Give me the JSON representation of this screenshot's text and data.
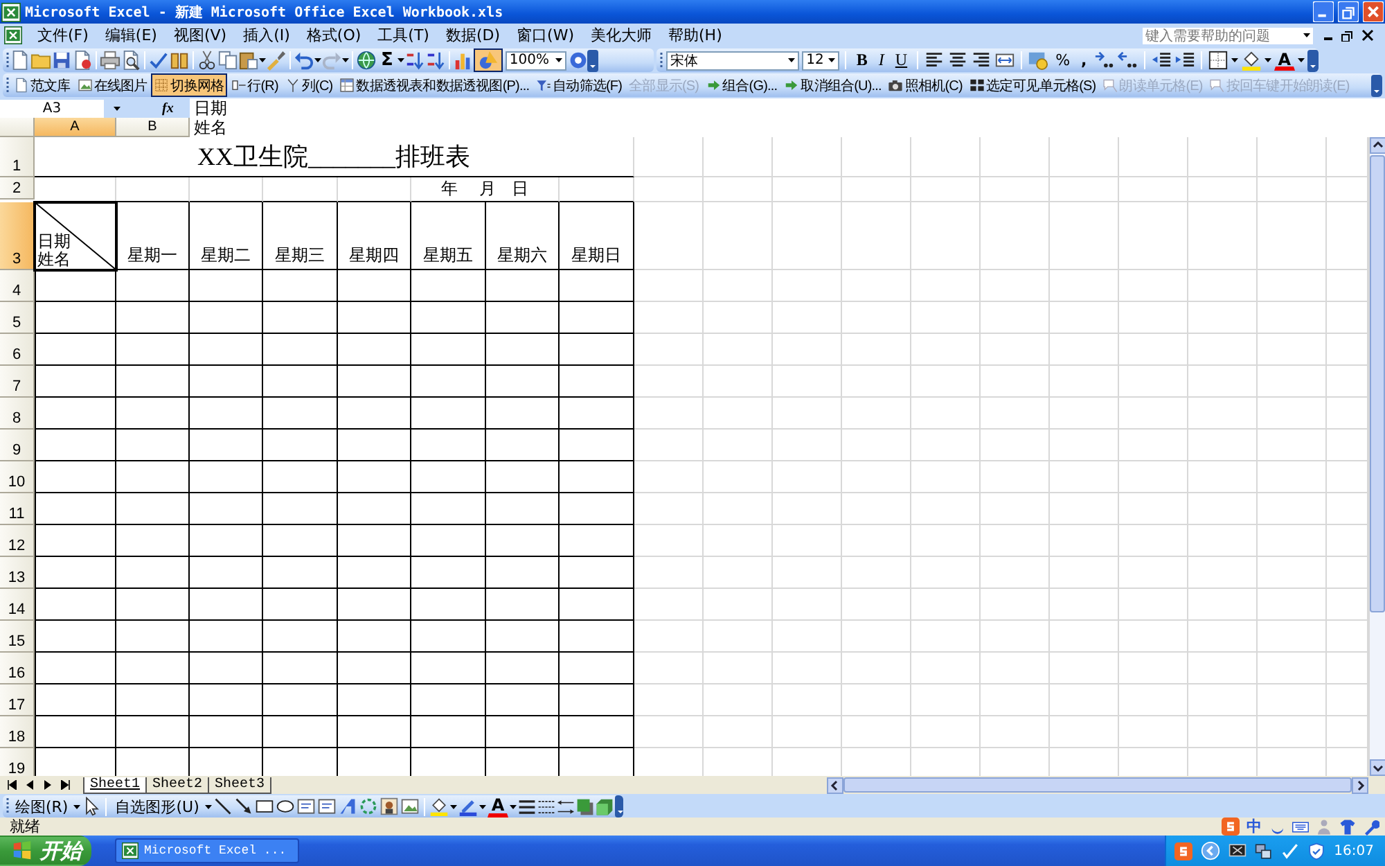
{
  "window": {
    "title": "Microsoft Excel - 新建 Microsoft Office Excel Workbook.xls"
  },
  "menu": {
    "items": [
      "文件(F)",
      "编辑(E)",
      "视图(V)",
      "插入(I)",
      "格式(O)",
      "工具(T)",
      "数据(D)",
      "窗口(W)",
      "美化大师",
      "帮助(H)"
    ],
    "help_placeholder": "键入需要帮助的问题"
  },
  "standard_toolbar": {
    "sum": "Σ",
    "zoom": "100%",
    "drawing_pressed": true
  },
  "formatting_toolbar": {
    "font": "宋体",
    "size": "12",
    "bold": "B",
    "italic": "I",
    "underline": "U",
    "percent": "%",
    "comma": ",",
    "font_color": "A"
  },
  "custom_toolbar": {
    "items": [
      {
        "label": "范文库",
        "pressed": false,
        "disabled": false
      },
      {
        "label": "在线图片",
        "pressed": false,
        "disabled": false
      },
      {
        "label": "切换网格",
        "pressed": true,
        "disabled": false
      },
      {
        "label": "行(R)",
        "pressed": false,
        "disabled": false
      },
      {
        "label": "列(C)",
        "pressed": false,
        "disabled": false
      },
      {
        "label": "数据透视表和数据透视图(P)...",
        "pressed": false,
        "disabled": false
      },
      {
        "label": "自动筛选(F)",
        "pressed": false,
        "disabled": false
      },
      {
        "label": "全部显示(S)",
        "pressed": false,
        "disabled": true
      },
      {
        "label": "组合(G)...",
        "pressed": false,
        "disabled": false
      },
      {
        "label": "取消组合(U)...",
        "pressed": false,
        "disabled": false
      },
      {
        "label": "照相机(C)",
        "pressed": false,
        "disabled": false
      },
      {
        "label": "选定可见单元格(S)",
        "pressed": false,
        "disabled": false
      },
      {
        "label": "朗读单元格(E)",
        "pressed": false,
        "disabled": true
      },
      {
        "label": "按回车键开始朗读(E)",
        "pressed": false,
        "disabled": true
      }
    ]
  },
  "formula_bar": {
    "name_box": "A3",
    "function_label": "fx",
    "content": [
      "日期",
      "姓名"
    ]
  },
  "sheet": {
    "columns": [
      {
        "label": "A",
        "selected": true
      },
      {
        "label": "B",
        "selected": false
      }
    ],
    "rows": [
      {
        "label": "1",
        "selected": false
      },
      {
        "label": "2",
        "selected": false
      },
      {
        "label": "3",
        "selected": true
      },
      {
        "label": "4",
        "selected": false
      },
      {
        "label": "5",
        "selected": false
      },
      {
        "label": "6",
        "selected": false
      },
      {
        "label": "7",
        "selected": false
      },
      {
        "label": "8",
        "selected": false
      },
      {
        "label": "9",
        "selected": false
      },
      {
        "label": "10",
        "selected": false
      },
      {
        "label": "11",
        "selected": false
      },
      {
        "label": "12",
        "selected": false
      },
      {
        "label": "13",
        "selected": false
      },
      {
        "label": "14",
        "selected": false
      },
      {
        "label": "15",
        "selected": false
      },
      {
        "label": "16",
        "selected": false
      },
      {
        "label": "17",
        "selected": false
      },
      {
        "label": "18",
        "selected": false
      },
      {
        "label": "19",
        "selected": false
      }
    ],
    "title": "XX卫生院_______排班表",
    "date_line": "年    月   日",
    "corner": [
      "日期",
      "姓名"
    ],
    "weekdays": [
      "星期一",
      "星期二",
      "星期三",
      "星期四",
      "星期五",
      "星期六",
      "星期日"
    ]
  },
  "sheet_tabs": [
    {
      "label": "Sheet1",
      "selected": true
    },
    {
      "label": "Sheet2",
      "selected": false
    },
    {
      "label": "Sheet3",
      "selected": false
    }
  ],
  "drawing_toolbar": {
    "draw": "绘图(R)",
    "autoshapes": "自选图形(U)",
    "font_color": "A"
  },
  "status_bar": {
    "text": "就绪",
    "ime_mode": "中"
  },
  "taskbar": {
    "start": "开始",
    "tasks": [
      "Microsoft Excel ..."
    ],
    "clock": "16:07"
  }
}
